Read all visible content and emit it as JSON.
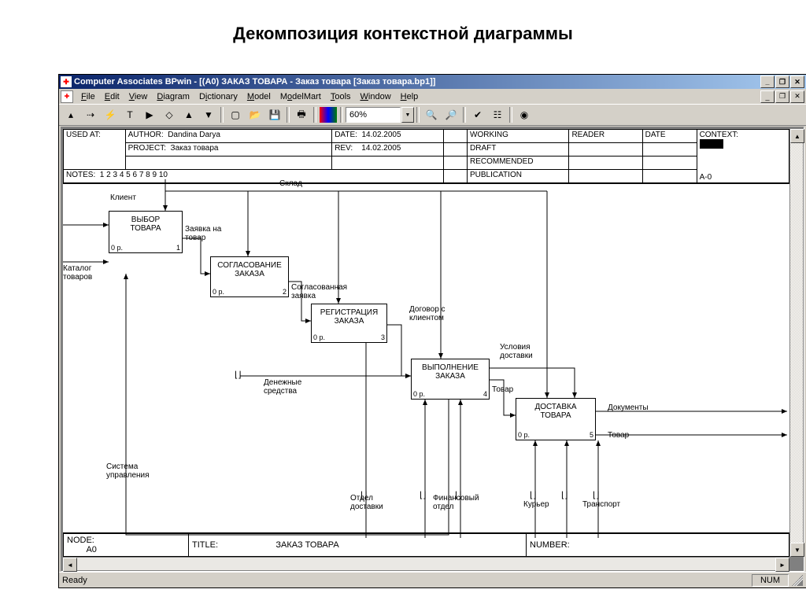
{
  "page_heading": "Декомпозиция контекстной диаграммы",
  "titlebar": "Computer Associates BPwin - [(A0) ЗАКАЗ ТОВАРА  - Заказ товара  [Заказ товара.bp1]]",
  "menu": {
    "file": "File",
    "edit": "Edit",
    "view": "View",
    "diagram": "Diagram",
    "dictionary": "Dictionary",
    "model": "Model",
    "modelmart": "ModelMart",
    "tools": "Tools",
    "window": "Window",
    "help": "Help"
  },
  "zoom": "60%",
  "status": {
    "ready": "Ready",
    "num": "NUM"
  },
  "header": {
    "used_at": "USED AT:",
    "author_lbl": "AUTHOR:",
    "author": "Dandina Darya",
    "project_lbl": "PROJECT:",
    "project": "Заказ товара",
    "date_lbl": "DATE:",
    "date": "14.02.2005",
    "rev_lbl": "REV:",
    "rev": "14.02.2005",
    "working": "WORKING",
    "draft": "DRAFT",
    "recommended": "RECOMMENDED",
    "publication": "PUBLICATION",
    "reader": "READER",
    "hdr_date": "DATE",
    "context": "CONTEXT:",
    "notes_lbl": "NOTES:",
    "notes": "1  2  3  4  5  6  7  8  9  10",
    "a0": "A-0"
  },
  "footer": {
    "node_lbl": "NODE:",
    "node": "A0",
    "title_lbl": "TITLE:",
    "title": "ЗАКАЗ ТОВАРА",
    "number_lbl": "NUMBER:"
  },
  "boxes": {
    "b1": {
      "t1": "ВЫБОР",
      "t2": "ТОВАРА",
      "cost": "0 р.",
      "n": "1"
    },
    "b2": {
      "t1": "СОГЛАСОВАНИЕ",
      "t2": "ЗАКАЗА",
      "cost": "0 р.",
      "n": "2"
    },
    "b3": {
      "t1": "РЕГИСТРАЦИЯ",
      "t2": "ЗАКАЗА",
      "cost": "0 р.",
      "n": "3"
    },
    "b4": {
      "t1": "ВЫПОЛНЕНИЕ",
      "t2": "ЗАКАЗА",
      "cost": "0 р.",
      "n": "4"
    },
    "b5": {
      "t1": "ДОСТАВКА",
      "t2": "ТОВАРА",
      "cost": "0 р.",
      "n": "5"
    }
  },
  "labels": {
    "klient": "Клиент",
    "katalog": "Каталог товаров",
    "sklad": "Склад",
    "zayavka": "Заявка на товар",
    "soglas": "Согласованная заявка",
    "dogovor": "Договор с клиентом",
    "usloviya": "Условия доставки",
    "dokumenty": "Документы",
    "tovar_out": "Товар",
    "tovar_mid": "Товар",
    "dengi": "Денежные средства",
    "sistema": "Система управления",
    "otdel": "Отдел доставки",
    "fin": "Финансовый отдел",
    "kuryer": "Курьер",
    "transport": "Транспорт"
  }
}
